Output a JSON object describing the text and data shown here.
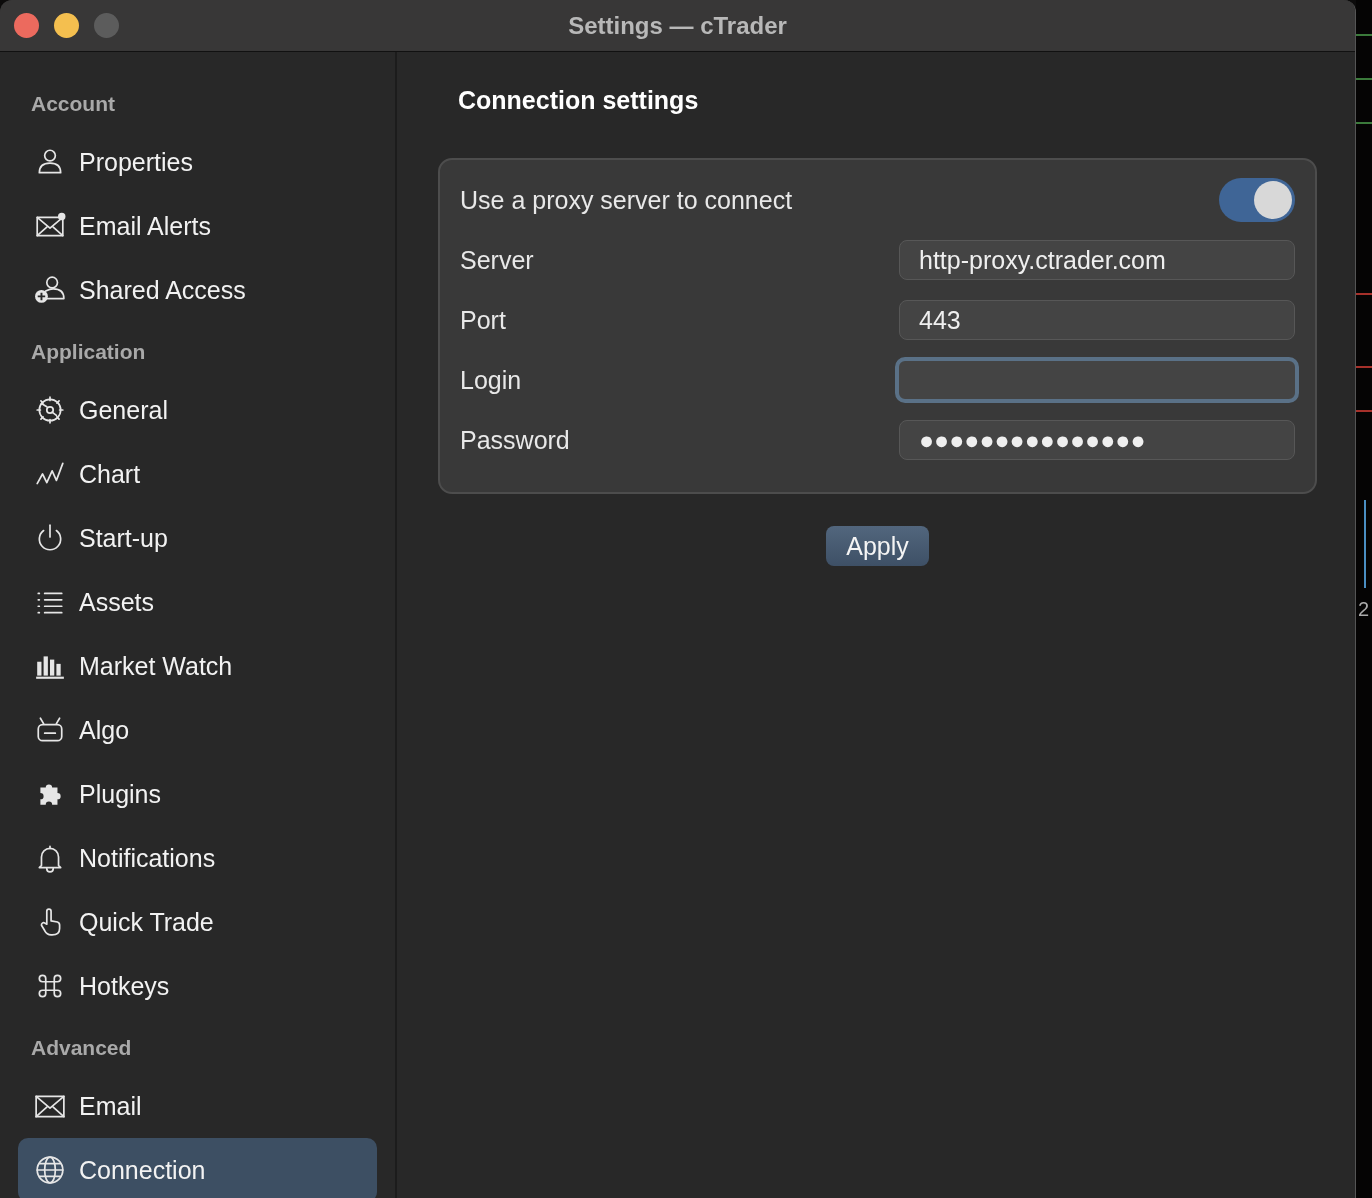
{
  "window": {
    "title": "Settings — cTrader"
  },
  "sidebar": {
    "sections": [
      {
        "header": "Account",
        "items": [
          {
            "label": "Properties",
            "selected": false
          },
          {
            "label": "Email Alerts",
            "selected": false
          },
          {
            "label": "Shared Access",
            "selected": false
          }
        ]
      },
      {
        "header": "Application",
        "items": [
          {
            "label": "General",
            "selected": false
          },
          {
            "label": "Chart",
            "selected": false
          },
          {
            "label": "Start-up",
            "selected": false
          },
          {
            "label": "Assets",
            "selected": false
          },
          {
            "label": "Market Watch",
            "selected": false
          },
          {
            "label": "Algo",
            "selected": false
          },
          {
            "label": "Plugins",
            "selected": false
          },
          {
            "label": "Notifications",
            "selected": false
          },
          {
            "label": "Quick Trade",
            "selected": false
          },
          {
            "label": "Hotkeys",
            "selected": false
          }
        ]
      },
      {
        "header": "Advanced",
        "items": [
          {
            "label": "Email",
            "selected": false
          },
          {
            "label": "Connection",
            "selected": true
          }
        ]
      }
    ]
  },
  "content": {
    "title": "Connection settings",
    "proxy_toggle": {
      "label": "Use a proxy server to connect",
      "on": true
    },
    "fields": [
      {
        "label": "Server",
        "value": "http-proxy.ctrader.com",
        "focused": false
      },
      {
        "label": "Port",
        "value": "443",
        "focused": false
      },
      {
        "label": "Login",
        "focused": true
      },
      {
        "label": "Password",
        "value": "●●●●●●●●●●●●●●●",
        "focused": false
      }
    ],
    "apply_button": "Apply"
  },
  "background_window": {
    "text": "2"
  }
}
